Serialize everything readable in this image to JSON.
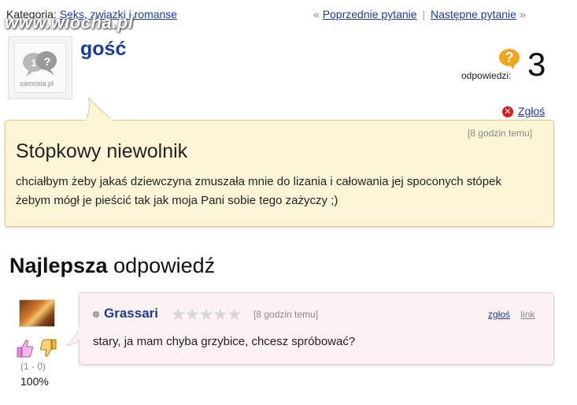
{
  "category": {
    "label": "Kategoria:",
    "value": "Seks, związki i romanse"
  },
  "watermark": "www.wiocha.pl",
  "nav": {
    "prev_marker": "«",
    "prev": "Poprzednie pytanie",
    "sep": "|",
    "next": "Następne pytanie",
    "next_marker": "»"
  },
  "avatar": {
    "caption": "samosia.pl"
  },
  "user": "gość",
  "answers": {
    "icon": "?",
    "label": "odpowiedzi:",
    "count": "3"
  },
  "report": "Zgłoś",
  "question": {
    "time": "[8 godzin temu]",
    "title": "Stópkowy niewolnik",
    "body": "chciałbym żeby jakaś dziewczyna zmuszała mnie do lizania i całowania jej spoconych stópek żebym mógł je pieścić tak jak moja Pani sobie tego zażyczy ;)"
  },
  "best": {
    "bold": "Najlepsza",
    "rest": "odpowiedź"
  },
  "answer": {
    "author": "Grassari",
    "stars": "★★★★★",
    "time": "[8 godzin temu]",
    "report": "zgłoś",
    "link": "link",
    "text": "stary, ja mam chyba grzybice, chcesz spróbować?",
    "votes": "(1 - 0)",
    "percent": "100%"
  },
  "colors": {
    "link": "#1b3c9b",
    "question_bg": "#fdf6d6",
    "answer_bg": "#fdf2f2",
    "accent": "#f0a51a",
    "report": "#d81e1e"
  }
}
